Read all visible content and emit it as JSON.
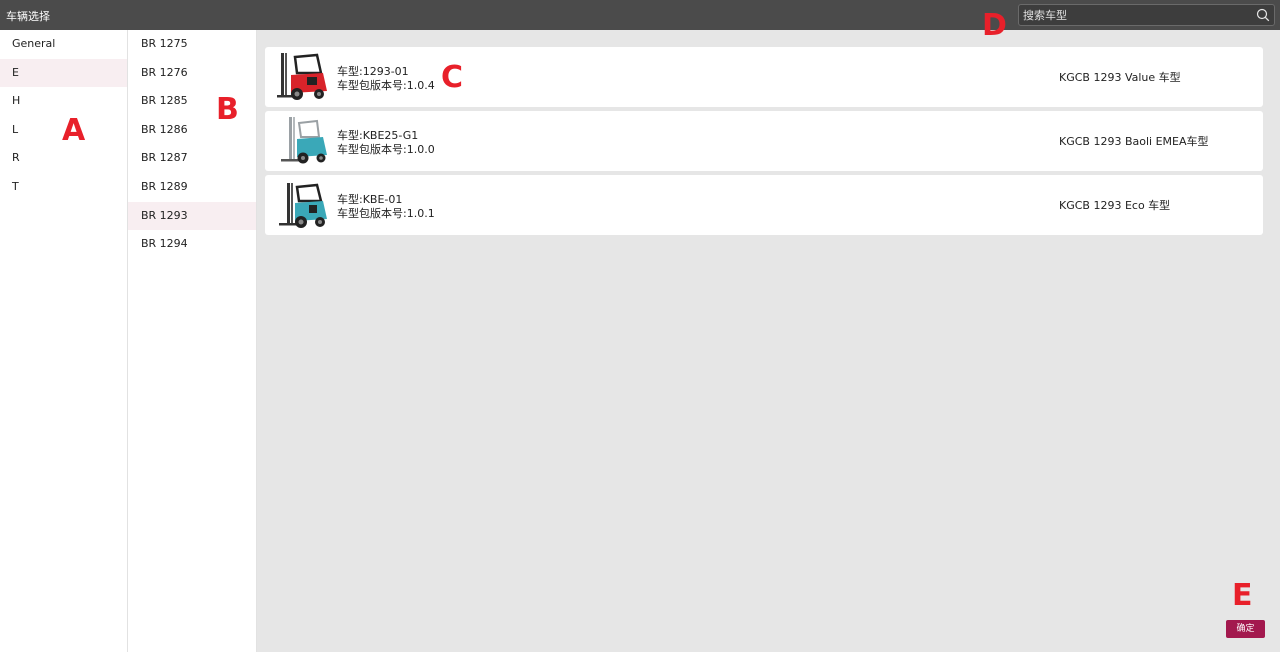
{
  "window": {
    "title": "车辆选择"
  },
  "search": {
    "placeholder": "搜索车型",
    "icon": "search-icon"
  },
  "column_a": {
    "items": [
      {
        "label": "General",
        "selected": false
      },
      {
        "label": "E",
        "selected": true
      },
      {
        "label": "H",
        "selected": false
      },
      {
        "label": "L",
        "selected": false
      },
      {
        "label": "R",
        "selected": false
      },
      {
        "label": "T",
        "selected": false
      }
    ]
  },
  "column_b": {
    "items": [
      {
        "label": "BR 1275",
        "selected": false
      },
      {
        "label": "BR 1276",
        "selected": false
      },
      {
        "label": "BR 1285",
        "selected": false
      },
      {
        "label": "BR 1286",
        "selected": false
      },
      {
        "label": "BR 1287",
        "selected": false
      },
      {
        "label": "BR 1289",
        "selected": false
      },
      {
        "label": "BR 1293",
        "selected": true
      },
      {
        "label": "BR 1294",
        "selected": false
      }
    ]
  },
  "vehicles": [
    {
      "model": "车型:1293-01",
      "version": "车型包版本号:1.0.4",
      "description": "KGCB 1293 Value 车型",
      "image_icon": "forklift-red-icon"
    },
    {
      "model": "车型:KBE25-G1",
      "version": "车型包版本号:1.0.0",
      "description": "KGCB 1293 Baoli EMEA车型",
      "image_icon": "forklift-teal-icon"
    },
    {
      "model": "车型:KBE-01",
      "version": "车型包版本号:1.0.1",
      "description": "KGCB 1293 Eco 车型",
      "image_icon": "forklift-teal-icon"
    }
  ],
  "footer": {
    "confirm_label": "确定"
  },
  "annotations": {
    "a": "A",
    "b": "B",
    "c": "C",
    "d": "D",
    "e": "E"
  },
  "colors": {
    "titlebar": "#4b4b4b",
    "selected_row": "#f8eef1",
    "confirm_button": "#a3194e",
    "marker": "#e8202a",
    "forklift_red": "#d8232a",
    "forklift_teal": "#3aa8b8"
  }
}
